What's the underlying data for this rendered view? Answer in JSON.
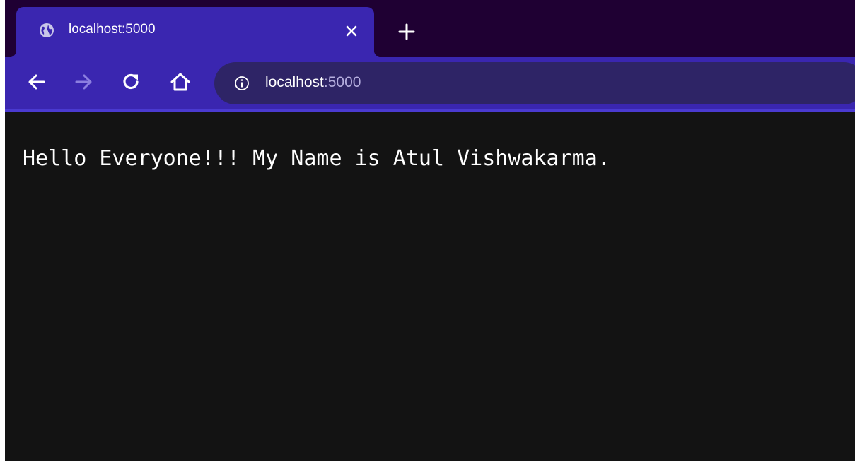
{
  "colors": {
    "frame": "#1f0033",
    "accent": "#3a26b0",
    "omnibox": "#2e2466",
    "page_background": "#131313",
    "text": "#ffffff",
    "port_text": "#b5aede"
  },
  "tab": {
    "title": "localhost:5000",
    "favicon": "globe-icon",
    "close_icon": "close-icon"
  },
  "tabstrip": {
    "new_tab_icon": "plus-icon"
  },
  "toolbar": {
    "back_icon": "arrow-left-icon",
    "forward_icon": "arrow-right-icon",
    "forward_enabled": false,
    "reload_icon": "reload-icon",
    "home_icon": "home-icon"
  },
  "omnibox": {
    "security_icon": "info-icon",
    "host": "localhost",
    "port": ":5000"
  },
  "page": {
    "text": "Hello Everyone!!! My Name is Atul Vishwakarma."
  }
}
